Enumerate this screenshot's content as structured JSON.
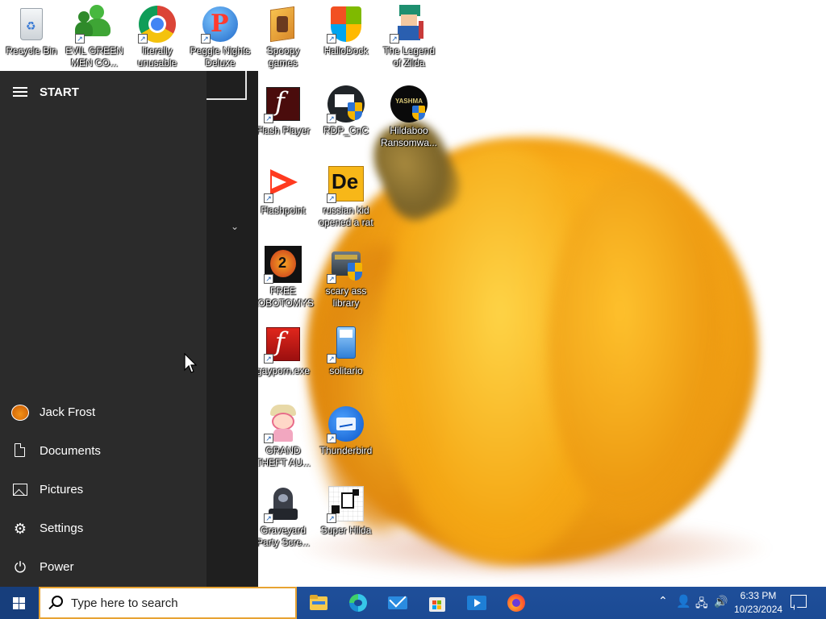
{
  "desktop": {
    "icons": [
      {
        "label": "Recycle Bin",
        "icon": "recycle-bin-icon",
        "shortcut": false
      },
      {
        "label": "EVIL GREEN\nMEN CO...",
        "icon": "green-people-icon",
        "shortcut": true
      },
      {
        "label": "literally\nunusable",
        "icon": "chrome-icon",
        "shortcut": true
      },
      {
        "label": "Peggle Nights\nDeluxe",
        "icon": "peggle-icon",
        "shortcut": true
      },
      {
        "label": "Spoopy\ngames",
        "icon": "folder-icon",
        "shortcut": false
      },
      {
        "label": "HalloDock",
        "icon": "shield-icon",
        "shortcut": true
      },
      {
        "label": "The Legend\nof Zilda",
        "icon": "pixel-character-icon",
        "shortcut": true
      },
      {
        "label": "Flash Player",
        "icon": "flash-player-icon",
        "shortcut": true
      },
      {
        "label": "RDP_CnC",
        "icon": "rdp-icon",
        "shortcut": true
      },
      {
        "label": "Hildaboo\nRansomwa...",
        "icon": "yashma-icon",
        "shortcut": false
      },
      {
        "label": "Flashpoint",
        "icon": "flashpoint-icon",
        "shortcut": true
      },
      {
        "label": "russian kid\nopened a rat",
        "icon": "de-icon",
        "shortcut": true
      },
      {
        "label": "FREE\nLOBOTOMYS",
        "icon": "lobotomy-icon",
        "shortcut": true
      },
      {
        "label": "scary ass\nlibrary",
        "icon": "library-icon",
        "shortcut": true
      },
      {
        "label": "gayporn.exe",
        "icon": "flash-icon",
        "shortcut": true
      },
      {
        "label": "solitario",
        "icon": "solitario-icon",
        "shortcut": true
      },
      {
        "label": "GRAND\nTHEFT AU...",
        "icon": "anime-girl-icon",
        "shortcut": true
      },
      {
        "label": "Thunderbird",
        "icon": "thunderbird-icon",
        "shortcut": true
      },
      {
        "label": "Graveyard\nParty Scre...",
        "icon": "graveyard-icon",
        "shortcut": true
      },
      {
        "label": "Super Hilda",
        "icon": "pixel-dog-icon",
        "shortcut": true
      }
    ]
  },
  "start_menu": {
    "title": "START",
    "items": [
      {
        "label": "Jack Frost",
        "icon": "user-avatar-icon"
      },
      {
        "label": "Documents",
        "icon": "document-icon"
      },
      {
        "label": "Pictures",
        "icon": "pictures-icon"
      },
      {
        "label": "Settings",
        "icon": "gear-icon"
      },
      {
        "label": "Power",
        "icon": "power-icon"
      }
    ]
  },
  "taskbar": {
    "search_placeholder": "Type here to search",
    "pinned": [
      {
        "name": "file-explorer",
        "icon": "folder-icon"
      },
      {
        "name": "edge",
        "icon": "edge-icon"
      },
      {
        "name": "mail",
        "icon": "mail-icon"
      },
      {
        "name": "store",
        "icon": "store-icon"
      },
      {
        "name": "video",
        "icon": "video-player-icon"
      },
      {
        "name": "firefox",
        "icon": "firefox-icon"
      }
    ],
    "clock": {
      "time": "6:33 PM",
      "date": "10/23/2024"
    }
  },
  "colors": {
    "taskbar": "#1b4a94",
    "start_menu": "#2b2b2b",
    "search_border": "#e7a332"
  }
}
